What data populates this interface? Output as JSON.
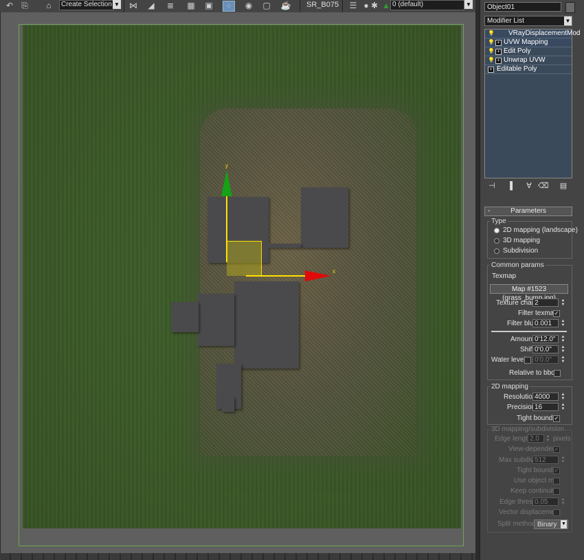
{
  "toolbar": {
    "selection_set": "Create Selection Se",
    "material_name": "SR_B075",
    "layer": "0 (default)",
    "icons": [
      "undo-redo-icon",
      "select-link-icon",
      "named-selection-icon",
      "mirror-icon",
      "align-icon",
      "layer-manager-icon",
      "curve-editor-icon",
      "schematic-view-icon",
      "material-editor-icon",
      "render-setup-icon",
      "rendered-frame-icon",
      "render-icon",
      "layer-stack-icon",
      "visibility-icon",
      "freeze-icon"
    ]
  },
  "viewport": {
    "gizmo": {
      "x_label": "x",
      "y_label": "y"
    },
    "colors": {
      "grass": "#3a5727",
      "dirt": "#5a5540",
      "building": "#4a4a4c",
      "x_axis": "#e10a0a",
      "y_axis": "#16a116",
      "gizmo": "#ffe100"
    }
  },
  "panel": {
    "object_name": "Object01",
    "modifier_list_label": "Modifier List",
    "stack": [
      {
        "label": "VRayDisplacementMod",
        "has_expand": false,
        "has_bulb": true
      },
      {
        "label": "UVW Mapping",
        "has_expand": true,
        "has_bulb": true
      },
      {
        "label": "Edit Poly",
        "has_expand": true,
        "has_bulb": true
      },
      {
        "label": "Unwrap UVW",
        "has_expand": true,
        "has_bulb": true
      },
      {
        "label": "Editable Poly",
        "has_expand": true,
        "has_bulb": false
      }
    ],
    "parameters": {
      "title": "Parameters",
      "collapse": "-",
      "type_group": "Type",
      "type_options": [
        "2D mapping (landscape)",
        "3D mapping",
        "Subdivision"
      ],
      "type_selected": 0,
      "common_group": "Common params",
      "texmap_label": "Texmap",
      "texmap_value": "Map #1523 (grass_bump.jpg)",
      "texture_chan_label": "Texture chan",
      "texture_chan_value": "2",
      "filter_texmap_label": "Filter texmap",
      "filter_texmap_checked": true,
      "filter_blur_label": "Filter blur",
      "filter_blur_value": "0.001",
      "amount_label": "Amount",
      "amount_value": "0'12.0\"",
      "shift_label": "Shift",
      "shift_value": "0'0.0\"",
      "water_level_label": "Water level",
      "water_level_value": "0'0.0\"",
      "relative_bbox_label": "Relative to bbox",
      "mapping2d_group": "2D mapping",
      "resolution_label": "Resolution",
      "resolution_value": "4000",
      "precision_label": "Precision",
      "precision_value": "16",
      "tight_bounds_label": "Tight bounds",
      "mapping3d_group": "3D mapping/subdivision",
      "edge_length_label": "Edge length",
      "edge_length_value": "2.0",
      "pixels_label": "pixels",
      "view_dependent_label": "View-dependent",
      "max_subdivs_label": "Max subdivs",
      "max_subdivs_value": "512",
      "tight_bounds3d_label": "Tight bounds",
      "use_object_mtl_label": "Use object mtl",
      "keep_continuity_label": "Keep continuity",
      "edge_thresh_label": "Edge thresh",
      "edge_thresh_value": "0.05",
      "vector_disp_label": "Vector displacement",
      "split_method_label": "Split method",
      "split_method_value": "Binary"
    }
  }
}
